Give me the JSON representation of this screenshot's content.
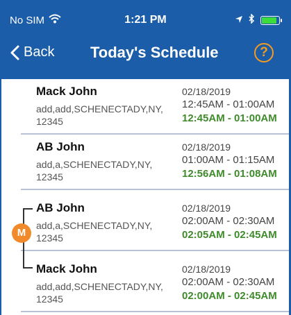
{
  "status_bar": {
    "carrier": "No SIM",
    "wifi_icon": "wifi-icon",
    "time": "1:21 PM",
    "location_icon": "location-arrow-icon",
    "bluetooth_icon": "bluetooth-icon",
    "battery_icon": "battery-icon",
    "battery_level": 0.9,
    "battery_color": "#3cdc3c"
  },
  "nav": {
    "back_label": "Back",
    "title": "Today's Schedule",
    "help_label": "?"
  },
  "colors": {
    "header_bg": "#1b5da8",
    "accent_orange": "#f39a21",
    "actual_time_green": "#3f8b2b",
    "separator": "#b7c3d5"
  },
  "appointments": [
    {
      "name": "Mack John",
      "address": "add,add,SCHENECTADY,NY, 12345",
      "date": "02/18/2019",
      "scheduled_start": "12:45AM",
      "scheduled_end": "01:00AM",
      "actual_start": "12:45AM",
      "actual_end": "01:00AM"
    },
    {
      "name": "AB John",
      "address": "add,a,SCHENECTADY,NY, 12345",
      "date": "02/18/2019",
      "scheduled_start": "01:00AM",
      "scheduled_end": "01:15AM",
      "actual_start": "12:56AM",
      "actual_end": "01:08AM"
    },
    {
      "name": "AB John",
      "address": "add,a,SCHENECTADY,NY, 12345",
      "date": "02/18/2019",
      "scheduled_start": "02:00AM",
      "scheduled_end": "02:30AM",
      "actual_start": "02:05AM",
      "actual_end": "02:45AM"
    },
    {
      "name": "Mack John",
      "address": "add,add,SCHENECTADY,NY, 12345",
      "date": "02/18/2019",
      "scheduled_start": "02:00AM",
      "scheduled_end": "02:30AM",
      "actual_start": "02:00AM",
      "actual_end": "02:45AM"
    }
  ],
  "merge_badge": {
    "label": "M",
    "icon": "merge-badge-icon"
  },
  "time_separator": " - "
}
